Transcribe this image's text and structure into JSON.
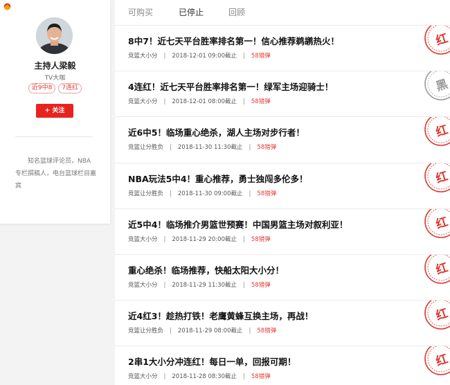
{
  "sidebar": {
    "host_name": "主持人梁毅",
    "host_subtitle": "TV大咖",
    "tags": [
      "近9中8",
      "7连红"
    ],
    "follow_label": "+ 关注",
    "bio": "知名篮球评论员，NBA专栏撰稿人，电台篮球栏目嘉宾"
  },
  "tabs": [
    {
      "label": "可购买",
      "active": false
    },
    {
      "label": "已停止",
      "active": true
    },
    {
      "label": "回顾",
      "active": false
    }
  ],
  "colors": {
    "accent_red": "#e8231f",
    "stamp_red": "#d93a33",
    "stamp_gray": "#9a9a9a"
  },
  "items": [
    {
      "title": "8中7！近七天平台胜率排名第一！信心推荐鹈鹕热火！",
      "category": "竞篮大小分",
      "time": "2018-12-01 09:00截止",
      "price": "58猎弹",
      "stamp": "红",
      "stamp_type": "red"
    },
    {
      "title": "4连红！近七天平台胜率排名第一！绿军主场迎骑士！",
      "category": "竞篮大小分",
      "time": "2018-12-01 08:00截止",
      "price": "58猎弹",
      "stamp": "黑",
      "stamp_type": "gray"
    },
    {
      "title": "近6中5！临场重心绝杀，湖人主场对步行者！",
      "category": "竞篮让分胜负",
      "time": "2018-11-30 11:30截止",
      "price": "58猎弹",
      "stamp": "红",
      "stamp_type": "red"
    },
    {
      "title": "NBA玩法5中4！重心推荐，勇士独闯多伦多！",
      "category": "竞篮让分胜负",
      "time": "2018-11-30 09:00截止",
      "price": "58猎弹",
      "stamp": "红",
      "stamp_type": "red"
    },
    {
      "title": "近5中4！临场推介男篮世预赛！中国男篮主场对叙利亚！",
      "category": "竞篮大小分",
      "time": "2018-11-29 20:00截止",
      "price": "58猎弹",
      "stamp": "红",
      "stamp_type": "red"
    },
    {
      "title": "重心绝杀！临场推荐，快船太阳大小分！",
      "category": "竞篮大小分",
      "time": "2018-11-29 11:30截止",
      "price": "58猎弹",
      "stamp": "红",
      "stamp_type": "red"
    },
    {
      "title": "近4红3！趁热打铁！老鹰黄蜂互换主场，再战！",
      "category": "竞篮让分胜负",
      "time": "2018-11-29 08:00截止",
      "price": "58猎弹",
      "stamp": "红",
      "stamp_type": "red"
    },
    {
      "title": "2串1大小分冲连红！每日一单，回报可期！",
      "category": "竞篮大小分",
      "time": "2018-11-28 08:30截止",
      "price": "58猎弹",
      "stamp": "红",
      "stamp_type": "red"
    }
  ]
}
